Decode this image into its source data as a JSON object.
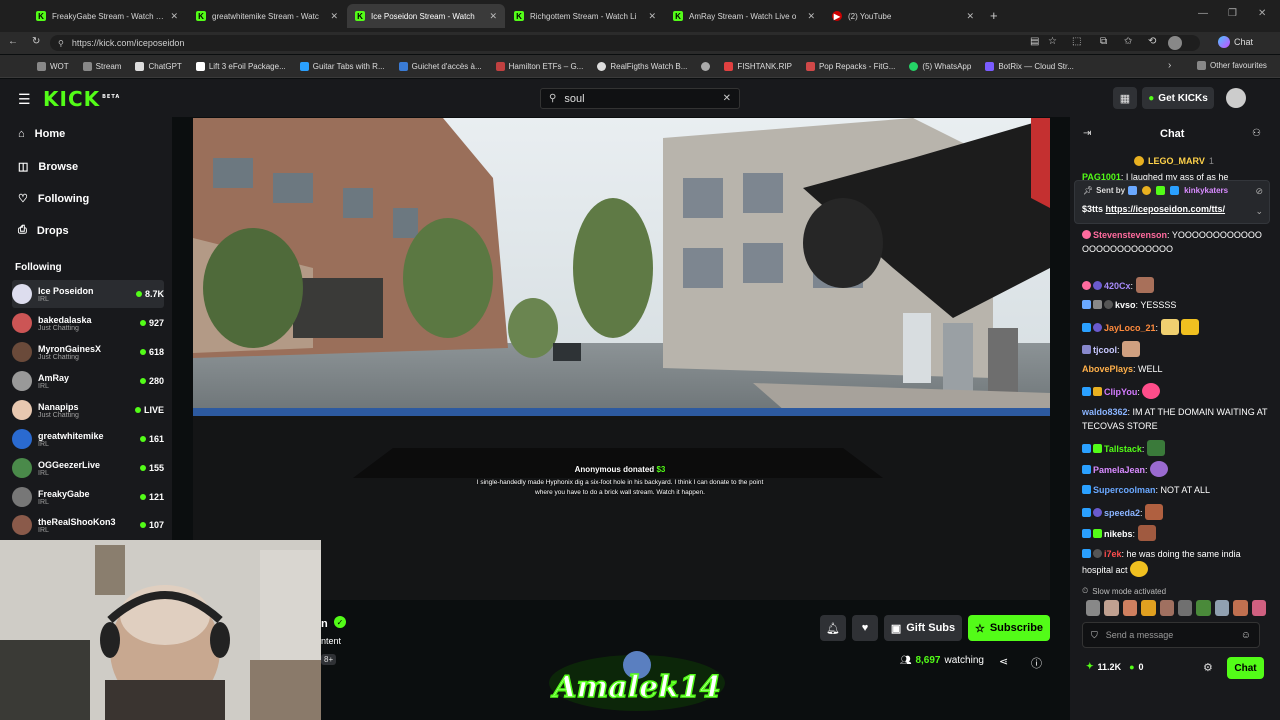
{
  "browser": {
    "tabs": [
      {
        "title": "FreakyGabe Stream - Watch Live o",
        "icon": "kick-favicon"
      },
      {
        "title": "greatwhitemike Stream - Watc",
        "icon": "kick-favicon"
      },
      {
        "title": "Ice Poseidon Stream - Watch",
        "icon": "kick-favicon"
      },
      {
        "title": "Richgottem Stream - Watch Li",
        "icon": "kick-favicon"
      },
      {
        "title": "AmRay Stream - Watch Live o",
        "icon": "kick-favicon"
      },
      {
        "title": "(2) YouTube",
        "icon": "youtube-favicon"
      }
    ],
    "url": "https://kick.com/iceposeidon",
    "profile_label": "Chat",
    "bookmarks": [
      "WOT",
      "Stream",
      "ChatGPT",
      "Lift 3 eFoil Package...",
      "Guitar Tabs with R...",
      "Guichet d'accès à...",
      "Hamilton ETFs – G...",
      "RealFigths Watch B...",
      "",
      "FISHTANK.RIP",
      "Pop Repacks - FitG...",
      "(5) WhatsApp",
      "BotRix — Cloud Str..."
    ],
    "other_favourites": "Other favourites"
  },
  "kick": {
    "logo": "KICK",
    "logo_tag": "BETA",
    "search": {
      "value": "soul"
    },
    "get_kicks": "Get KICKs",
    "nav": [
      {
        "label": "Home",
        "icon": "home-icon"
      },
      {
        "label": "Browse",
        "icon": "browse-icon"
      },
      {
        "label": "Following",
        "icon": "heart-icon"
      },
      {
        "label": "Drops",
        "icon": "drops-icon"
      }
    ],
    "following_heading": "Following",
    "following": [
      {
        "name": "Ice Poseidon",
        "category": "IRL",
        "viewers": "8.7K"
      },
      {
        "name": "bakedalaska",
        "category": "Just Chatting",
        "viewers": "927"
      },
      {
        "name": "MyronGainesX",
        "category": "Just Chatting",
        "viewers": "618"
      },
      {
        "name": "AmRay",
        "category": "IRL",
        "viewers": "280"
      },
      {
        "name": "Nanapips",
        "category": "Just Chatting",
        "viewers": "LIVE"
      },
      {
        "name": "greatwhitemike",
        "category": "IRL",
        "viewers": "161"
      },
      {
        "name": "OGGeezerLive",
        "category": "IRL",
        "viewers": "155"
      },
      {
        "name": "FreakyGabe",
        "category": "IRL",
        "viewers": "121"
      },
      {
        "name": "theRealShooKon3",
        "category": "IRL",
        "viewers": "107"
      }
    ]
  },
  "video": {
    "donation_title": "Anonymous donated",
    "donation_amount": "$3",
    "donation_message": "I single-handedly made Hyphonix dig a six-foot hole in his backyard. I think I can donate to the point where you have to do a brick wall stream. Watch it happen."
  },
  "stream_info": {
    "name_partial": "n",
    "category_partial": "ntent",
    "age_partial": "8+",
    "gift_subs": "Gift Subs",
    "subscribe": "Subscribe",
    "watching_count": "8,697",
    "watching_label": "watching"
  },
  "overlay": {
    "watermark": "Amalek14"
  },
  "chat": {
    "title": "Chat",
    "top_user": "LEGO_MARV",
    "top_user_count": "1",
    "partial_line_user": "PAG1001",
    "partial_line_text": ": I laughed my ass of as he",
    "pinned": {
      "sent_by": "Sent by",
      "sender": "kinkykaters",
      "text": "$3tts",
      "link": "https://iceposeidon.com/tts/"
    },
    "messages": [
      {
        "user": "Stevenstevenson",
        "color": "#ff6b9e",
        "text": "YOOOOOOOOOOOOOOOOOOOOOOOOO",
        "emote": false
      },
      {
        "user": "420Cx",
        "color": "#a78bfa",
        "text": "",
        "emote": true
      },
      {
        "user": "kvso",
        "color": "#ffffff",
        "text": "YESSSS",
        "emote": false
      },
      {
        "user": "JayLoco_21",
        "color": "#ff8b3d",
        "text": "",
        "emote": true
      },
      {
        "user": "tjcool",
        "color": "#c8c8ff",
        "text": "",
        "emote": true
      },
      {
        "user": "AbovePlays",
        "color": "#ffb04a",
        "text": "WELL",
        "emote": false
      },
      {
        "user": "ClipYou",
        "color": "#d47bff",
        "text": "",
        "emote": true
      },
      {
        "user": "waldo8362",
        "color": "#8ab4ff",
        "text": "IM AT THE DOMAIN WAITING AT TECOVAS STORE",
        "emote": false
      },
      {
        "user": "Tallstack",
        "color": "#53fc18",
        "text": "",
        "emote": true
      },
      {
        "user": "PamelaJean",
        "color": "#d88bff",
        "text": "",
        "emote": true
      },
      {
        "user": "Supercoolman",
        "color": "#6aa8ff",
        "text": "NOT AT ALL",
        "emote": false
      },
      {
        "user": "speeda2",
        "color": "#8ab4ff",
        "text": "",
        "emote": true
      },
      {
        "user": "nikebs",
        "color": "#ffffff",
        "text": "",
        "emote": true
      },
      {
        "user": "i7ek",
        "color": "#ff4d4d",
        "text": "he was doing the same india hospital act",
        "emote": true
      }
    ],
    "slow_mode": "Slow mode activated",
    "input_placeholder": "Send a message",
    "kicks_balance": "11.2K",
    "kicks_zero": "0",
    "chat_button": "Chat"
  }
}
